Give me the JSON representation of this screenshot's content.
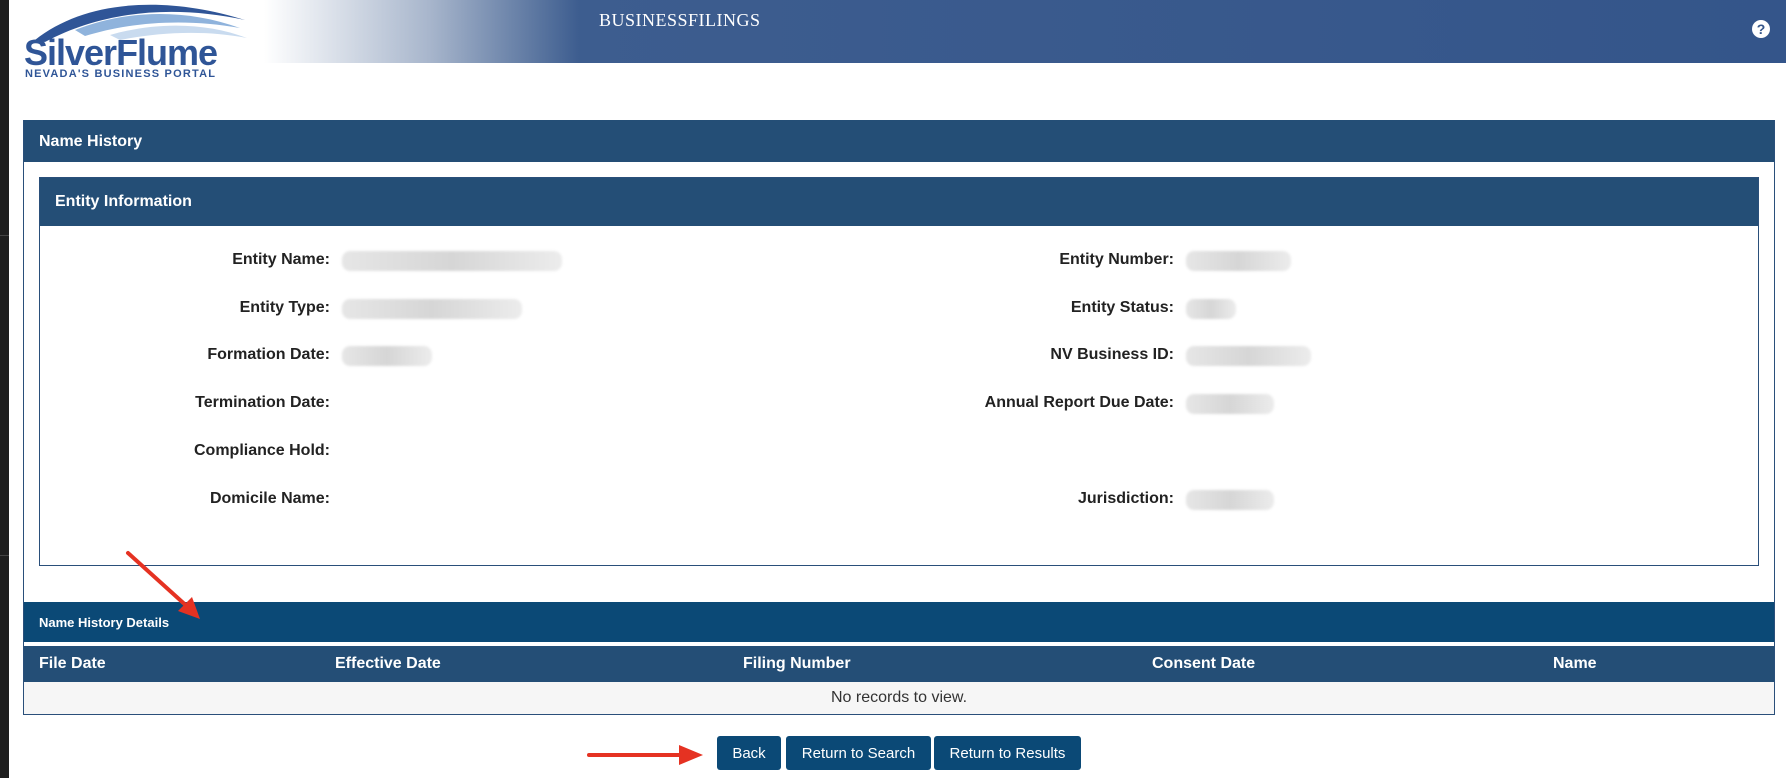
{
  "header": {
    "logo_wordmark": "SilverFlume",
    "logo_tagline": "NEVADA'S BUSINESS PORTAL",
    "title": "BUSINESSFILINGS",
    "help_icon": "question-circle-icon"
  },
  "panel": {
    "title": "Name History"
  },
  "entity": {
    "title": "Entity Information",
    "labels": {
      "entity_name": "Entity Name:",
      "entity_type": "Entity Type:",
      "formation_date": "Formation Date:",
      "termination_date": "Termination Date:",
      "compliance_hold": "Compliance Hold:",
      "domicile_name": "Domicile Name:",
      "entity_number": "Entity Number:",
      "entity_status": "Entity Status:",
      "nv_business_id": "NV Business ID:",
      "annual_report_due_date": "Annual Report Due Date:",
      "jurisdiction": "Jurisdiction:"
    }
  },
  "details": {
    "title": "Name History Details",
    "columns": [
      "File Date",
      "Effective Date",
      "Filing Number",
      "Consent Date",
      "Name"
    ],
    "empty_message": "No records to view."
  },
  "buttons": {
    "back": "Back",
    "return_to_search": "Return to Search",
    "return_to_results": "Return to Results"
  },
  "colors": {
    "header_blue": "#34558a",
    "panel_heading": "#244e76",
    "details_heading": "#0b4976",
    "annotation_arrow": "#e53222"
  }
}
